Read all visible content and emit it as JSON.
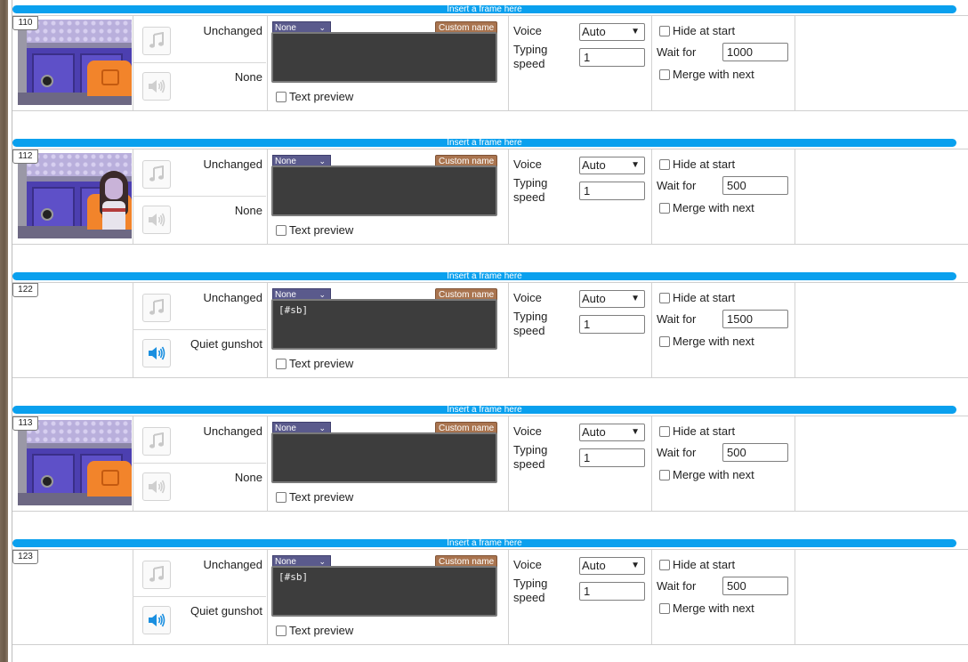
{
  "insert_label": "Insert a frame here",
  "labels": {
    "text_preview": "Text preview",
    "voice": "Voice",
    "typing_speed": "Typing\nspeed",
    "hide_at_start": "Hide at start",
    "wait_for": "Wait for",
    "merge_with_next": "Merge with next",
    "custom_name": "Custom name"
  },
  "icons": {
    "music": "music-note-icon",
    "sound": "speaker-icon"
  },
  "colors": {
    "insert_bar": "#0aa0ee",
    "dialog_bg": "#3d3d3d",
    "custom_name": "#a9744f",
    "speaker_select": "#5a5a8c"
  },
  "frames": [
    {
      "id": "110",
      "scene": "courtroom-chair",
      "music": "Unchanged",
      "sound": "None",
      "sound_active": false,
      "speaker": "None",
      "text": "",
      "voice": "Auto",
      "typing_speed": "1",
      "wait_for": "1000"
    },
    {
      "id": "112",
      "scene": "courtroom-character",
      "music": "Unchanged",
      "sound": "None",
      "sound_active": false,
      "speaker": "None",
      "text": "",
      "voice": "Auto",
      "typing_speed": "1",
      "wait_for": "500"
    },
    {
      "id": "122",
      "scene": "",
      "music": "Unchanged",
      "sound": "Quiet gunshot",
      "sound_active": true,
      "speaker": "None",
      "text": "[#sb]",
      "voice": "Auto",
      "typing_speed": "1",
      "wait_for": "1500"
    },
    {
      "id": "113",
      "scene": "courtroom-chair",
      "music": "Unchanged",
      "sound": "None",
      "sound_active": false,
      "speaker": "None",
      "text": "",
      "voice": "Auto",
      "typing_speed": "1",
      "wait_for": "500"
    },
    {
      "id": "123",
      "scene": "",
      "music": "Unchanged",
      "sound": "Quiet gunshot",
      "sound_active": true,
      "speaker": "None",
      "text": "[#sb]",
      "voice": "Auto",
      "typing_speed": "1",
      "wait_for": "500"
    }
  ]
}
